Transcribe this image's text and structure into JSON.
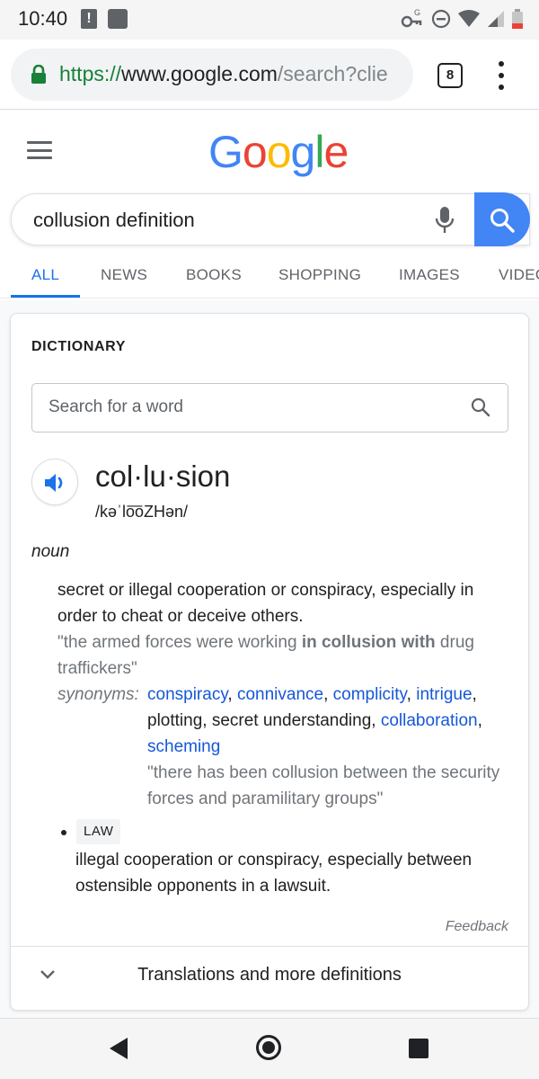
{
  "status_bar": {
    "time": "10:40",
    "alert_glyph": "!"
  },
  "browser": {
    "url_scheme": "https://",
    "url_host": "www.google.com",
    "url_path": "/search?clie",
    "tab_count": "8"
  },
  "google": {
    "logo_letters": [
      "G",
      "o",
      "o",
      "g",
      "l",
      "e"
    ],
    "logo_colors": [
      "#4285f4",
      "#ea4335",
      "#fbbc05",
      "#4285f4",
      "#34a853",
      "#ea4335"
    ],
    "query": "collusion definition",
    "tabs": [
      "ALL",
      "NEWS",
      "BOOKS",
      "SHOPPING",
      "IMAGES",
      "VIDEO"
    ],
    "active_tab": "ALL"
  },
  "dictionary": {
    "section_label": "DICTIONARY",
    "search_placeholder": "Search for a word",
    "headword": "col·lu·sion",
    "phonetic": "/kəˈlo͞oZHən/",
    "part_of_speech": "noun",
    "sense1": {
      "definition": "secret or illegal cooperation or conspiracy, especially in order to cheat or deceive others.",
      "example_prefix": "\"the armed forces were working ",
      "example_bold": "in collusion with",
      "example_suffix": " drug traffickers\"",
      "synonyms_label": "synonyms:",
      "synonyms": [
        {
          "text": "conspiracy",
          "link": true
        },
        {
          "text": "connivance",
          "link": true
        },
        {
          "text": "complicity",
          "link": true
        },
        {
          "text": "intrigue",
          "link": true
        },
        {
          "text": "plotting",
          "link": false
        },
        {
          "text": "secret understanding",
          "link": false
        },
        {
          "text": "collaboration",
          "link": true
        },
        {
          "text": "scheming",
          "link": true
        }
      ],
      "synonym_example": "\"there has been collusion between the security forces and paramilitary groups\""
    },
    "sense2": {
      "domain_label": "LAW",
      "definition": "illegal cooperation or conspiracy, especially between ostensible opponents in a lawsuit."
    },
    "feedback": "Feedback",
    "more_definitions": "Translations and more definitions"
  },
  "colors": {
    "link": "#1558d6",
    "accent_blue": "#1a73e8",
    "secure_green": "#188038"
  }
}
